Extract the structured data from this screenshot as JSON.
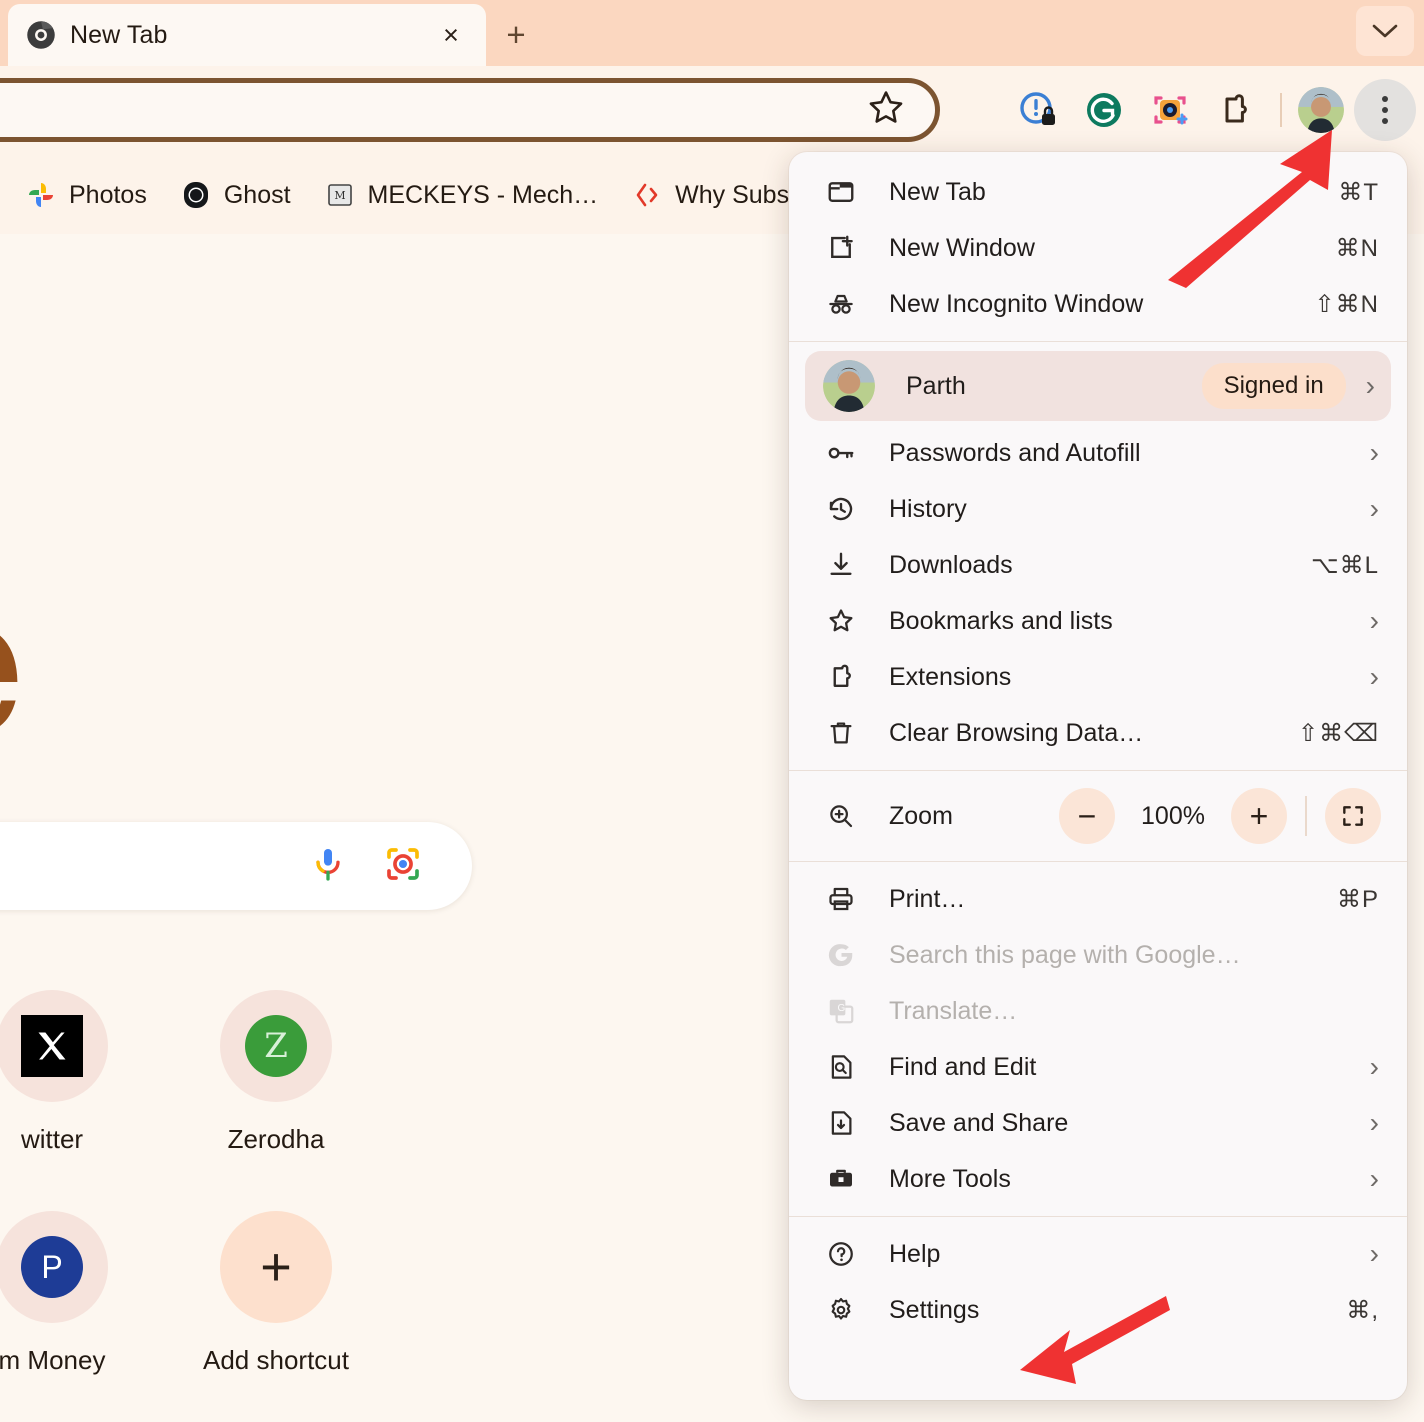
{
  "theme": {
    "accent": "#fbd7c0",
    "brand_brown": "#7c5430",
    "arrow_red": "#ef3232",
    "menu_bg": "#faf8f9"
  },
  "tabstrip": {
    "tab_title": "New Tab",
    "favicon_name": "chrome-favicon",
    "close_glyph": "×",
    "new_tab_glyph": "+",
    "chevron_glyph": "⌄"
  },
  "toolbar": {
    "bookmark_star_glyph": "☆",
    "icons": [
      {
        "name": "privacy-badger-icon"
      },
      {
        "name": "grammarly-icon"
      },
      {
        "name": "screenshot-tool-icon"
      },
      {
        "name": "extensions-puzzle-icon"
      }
    ],
    "avatar_name": "profile-avatar",
    "menu_name": "three-dot-menu-button"
  },
  "bookmarks": [
    {
      "label": "Photos",
      "icon": "google-photos-icon"
    },
    {
      "label": "Ghost",
      "icon": "ghost-icon"
    },
    {
      "label": "MECKEYS - Mech…",
      "icon": "meckeys-icon"
    },
    {
      "label": "Why Substa",
      "icon": "substack-icon"
    }
  ],
  "newtab": {
    "logo_text": "gle",
    "search_placeholder": "",
    "mic_icon": "microphone-icon",
    "lens_icon": "google-lens-icon",
    "shortcuts": [
      {
        "label": "witter",
        "icon": "twitter-x-icon",
        "glyph": "✕"
      },
      {
        "label": "Zerodha",
        "icon": "zerodha-icon",
        "glyph": "Z"
      },
      {
        "label": "m Money",
        "icon": "paytm-money-icon",
        "glyph": "P"
      },
      {
        "label": "Add shortcut",
        "icon": "add-shortcut-icon",
        "glyph": "+"
      }
    ]
  },
  "menu": {
    "group1": [
      {
        "label": "New Tab",
        "shortcut": "⌘T",
        "icon": "new-tab-icon",
        "chevron": false,
        "disabled": false
      },
      {
        "label": "New Window",
        "shortcut": "⌘N",
        "icon": "new-window-icon",
        "chevron": false,
        "disabled": false
      },
      {
        "label": "New Incognito Window",
        "shortcut": "⇧⌘N",
        "icon": "incognito-icon",
        "chevron": false,
        "disabled": false
      }
    ],
    "profile": {
      "name": "Parth",
      "status": "Signed in",
      "avatar": "profile-avatar",
      "chevron": "›"
    },
    "group2": [
      {
        "label": "Passwords and Autofill",
        "shortcut": "",
        "icon": "key-icon",
        "chevron": true,
        "disabled": false
      },
      {
        "label": "History",
        "shortcut": "",
        "icon": "history-icon",
        "chevron": true,
        "disabled": false
      },
      {
        "label": "Downloads",
        "shortcut": "⌥⌘L",
        "icon": "download-icon",
        "chevron": false,
        "disabled": false
      },
      {
        "label": "Bookmarks and lists",
        "shortcut": "",
        "icon": "star-icon",
        "chevron": true,
        "disabled": false
      },
      {
        "label": "Extensions",
        "shortcut": "",
        "icon": "puzzle-icon",
        "chevron": true,
        "disabled": false
      },
      {
        "label": "Clear Browsing Data…",
        "shortcut": "⇧⌘⌫",
        "icon": "trash-icon",
        "chevron": false,
        "disabled": false
      }
    ],
    "zoom": {
      "label": "Zoom",
      "icon": "zoom-magnifier-icon",
      "value": "100%",
      "minus": "−",
      "plus": "+",
      "fullscreen_icon": "fullscreen-icon"
    },
    "group3": [
      {
        "label": "Print…",
        "shortcut": "⌘P",
        "icon": "printer-icon",
        "chevron": false,
        "disabled": false
      },
      {
        "label": "Search this page with Google…",
        "shortcut": "",
        "icon": "google-g-icon",
        "chevron": false,
        "disabled": true
      },
      {
        "label": "Translate…",
        "shortcut": "",
        "icon": "translate-icon",
        "chevron": false,
        "disabled": true
      },
      {
        "label": "Find and Edit",
        "shortcut": "",
        "icon": "find-edit-icon",
        "chevron": true,
        "disabled": false
      },
      {
        "label": "Save and Share",
        "shortcut": "",
        "icon": "save-share-icon",
        "chevron": true,
        "disabled": false
      },
      {
        "label": "More Tools",
        "shortcut": "",
        "icon": "toolbox-icon",
        "chevron": true,
        "disabled": false
      }
    ],
    "group4": [
      {
        "label": "Help",
        "shortcut": "",
        "icon": "help-circle-icon",
        "chevron": true,
        "disabled": false
      },
      {
        "label": "Settings",
        "shortcut": "⌘,",
        "icon": "gear-icon",
        "chevron": false,
        "disabled": false
      }
    ]
  },
  "annotations": [
    {
      "name": "arrow-to-three-dot-menu",
      "points_to": "three-dot-menu-button"
    },
    {
      "name": "arrow-to-settings",
      "points_to": "Settings"
    }
  ]
}
